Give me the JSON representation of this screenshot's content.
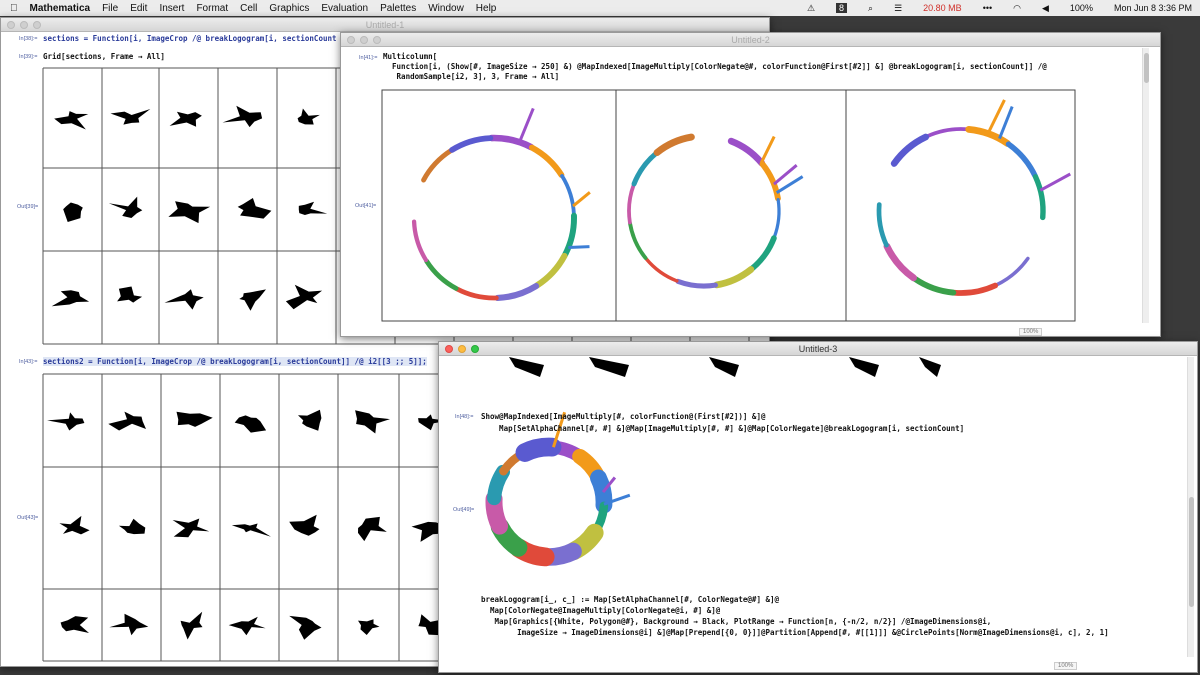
{
  "menubar": {
    "app": "Mathematica",
    "items": [
      "File",
      "Edit",
      "Insert",
      "Format",
      "Cell",
      "Graphics",
      "Evaluation",
      "Palettes",
      "Window",
      "Help"
    ],
    "status": {
      "badge": "8",
      "memory": "20.80 MB",
      "battery": "100%",
      "datetime": "Mon Jun 8  3:36 PM"
    }
  },
  "windows": [
    {
      "title": "Untitled-1",
      "cells": [
        {
          "label": "In[38]:=",
          "code": "sections = Function[i, ImageCrop /@ breakLogogram[i, sectionCount"
        },
        {
          "label": "In[39]:=",
          "code": "Grid[sections, Frame → All]"
        },
        {
          "label": "Out[39]=",
          "code": ""
        },
        {
          "label": "In[43]:=",
          "code": "sections2 = Function[i, ImageCrop /@ breakLogogram[i, sectionCount]] /@ i2[[3 ;; 5]];"
        },
        {
          "label": "Out[43]=",
          "code": ""
        }
      ]
    },
    {
      "title": "Untitled-2",
      "zoom": "100%",
      "cells": [
        {
          "label": "In[41]:=",
          "code": "Multicolumn[\n  Function[i, (Show[#, ImageSize → 250] &) @MapIndexed[ImageMultiply[ColorNegate@#, colorFunction@First[#2]] &] @breakLogogram[i, sectionCount]] /@\n   RandomSample[i2, 3], 3, Frame → All]"
        },
        {
          "label": "Out[41]=",
          "code": ""
        }
      ]
    },
    {
      "title": "Untitled-3",
      "zoom": "100%",
      "cells": [
        {
          "label": "In[48]:=",
          "code": "Show@MapIndexed[ImageMultiply[#, colorFunction@(First[#2])] &]@\n    Map[SetAlphaChannel[#, #] &]@Map[ImageMultiply[#, #] &]@Map[ColorNegate]@breakLogogram[i, sectionCount]"
        },
        {
          "label": "Out[49]=",
          "code": ""
        },
        {
          "label": "",
          "code": "breakLogogram[i_, c_] := Map[SetAlphaChannel[#, ColorNegate@#] &]@\n  Map[ColorNegate@ImageMultiply[ColorNegate@i, #] &]@\n   Map[Graphics[{White, Polygon@#}, Background → Black, PlotRange → Function[n, {-n/2, n/2}] /@ImageDimensions@i,\n        ImageSize → ImageDimensions@i] &]@Map[Prepend[{0, 0}]]@Partition[Append[#, #[[1]]] &@CirclePoints[Norm@ImageDimensions@i, c], 2, 1]"
        }
      ]
    }
  ],
  "colors": {
    "ring": [
      "#9b4fc8",
      "#f29a1a",
      "#3d7fd6",
      "#1fa37f",
      "#c0c040",
      "#7a6fd0",
      "#e04a3a",
      "#3aa04a",
      "#c85aa8",
      "#2a9ab0",
      "#d07a30",
      "#5a5ad0"
    ],
    "memory": "#d0302a"
  }
}
